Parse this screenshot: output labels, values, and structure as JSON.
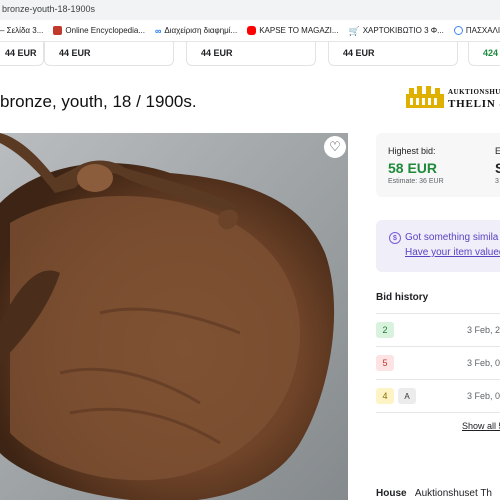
{
  "browser": {
    "url": "bronze-youth-18-1900s",
    "bookmarks": [
      {
        "label": "– Σελίδα 3...",
        "icon": "page-icon",
        "color": "#8a8a8a"
      },
      {
        "label": "Online Encyclopedia...",
        "icon": "encyclopedia-icon",
        "color": "#c0392b"
      },
      {
        "label": "Διαχείριση διαφημί...",
        "icon": "meta-icon",
        "color": "#1877f2"
      },
      {
        "label": "KAPSE TO MAGAZI...",
        "icon": "youtube-icon",
        "color": "#ff0000"
      },
      {
        "label": "ΧΑΡΤΟΚΙΒΩΤΙΟ 3 Φ...",
        "icon": "cart-icon",
        "color": "#555555"
      },
      {
        "label": "ΠΑΣΧΑΛΙΝΕΣ ΛΑΜ...",
        "icon": "search-icon",
        "color": "#4285f4"
      }
    ]
  },
  "top_cards": [
    "44 EUR",
    "44 EUR",
    "44 EUR",
    "44 EUR",
    "424"
  ],
  "item": {
    "title": "bronze, youth, 18 / 1900s.",
    "favorite_icon": "heart-icon"
  },
  "logo": {
    "line1": "AUKTIONSHUS",
    "line2": "THELIN &",
    "icon": "crown-icon"
  },
  "bid_panel": {
    "highest_bid_label": "Highest bid:",
    "highest_bid_value": "58 EUR",
    "estimate": "Estimate: 36 EUR",
    "second_label": "E",
    "second_value": "S",
    "second_est": "3"
  },
  "sell_panel": {
    "line1": "Got something simila",
    "line2": "Have your item valued",
    "icon": "dollar-circle-icon"
  },
  "bid_history": {
    "title": "Bid history",
    "rows": [
      {
        "number": "2",
        "date": "3 Feb, 2",
        "badge_color": "#d9f2dd",
        "text_color": "#1e7a35",
        "auto": ""
      },
      {
        "number": "5",
        "date": "3 Feb, 0",
        "badge_color": "#fde3e3",
        "text_color": "#c0392b",
        "auto": ""
      },
      {
        "number": "4",
        "date": "3 Feb, 0",
        "badge_color": "#fdf3c4",
        "text_color": "#8a6d00",
        "auto": "A"
      }
    ],
    "show_all": "Show all 5"
  },
  "bottom": {
    "label": "House",
    "value": "Auktionshuset Th"
  }
}
